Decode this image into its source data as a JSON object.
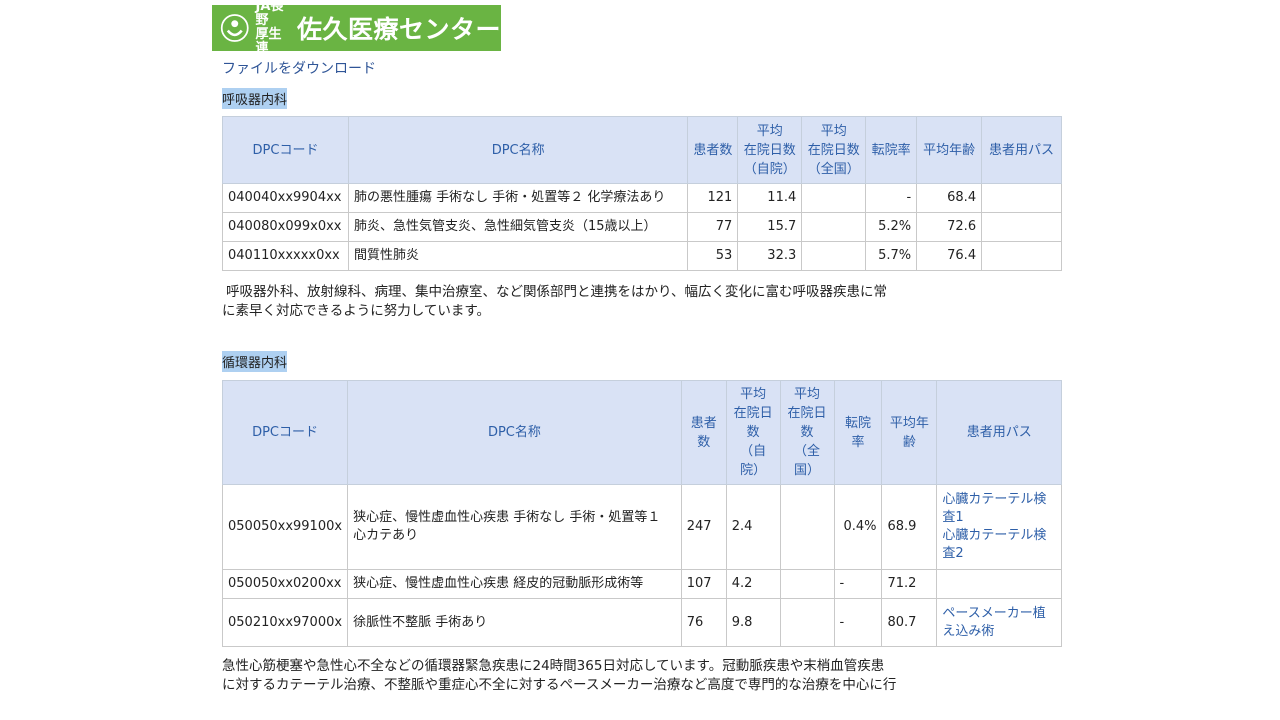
{
  "logo": {
    "line1": "JA長野",
    "line2": "厚生連",
    "name": "佐久医療センター",
    "brand_color": "#6ab443"
  },
  "download_link": "ファイルをダウンロード",
  "sections": [
    {
      "title": "呼吸器内科",
      "headers": {
        "code": "DPCコード",
        "name": "DPC名称",
        "patients": "患者数",
        "avg_days_hospital": [
          "平均",
          "在院日数",
          "（自院）"
        ],
        "avg_days_national": [
          "平均",
          "在院日数",
          "（全国）"
        ],
        "transfer": "転院率",
        "avg_age": "平均年齢",
        "path": "患者用パス"
      },
      "rows": [
        {
          "code": "040040xx9904xx",
          "name": "肺の悪性腫瘍 手術なし 手術・処置等２ 化学療法あり",
          "patients": "121",
          "days_hospital": "11.4",
          "days_national": "",
          "transfer": "-",
          "age": "68.4",
          "path": []
        },
        {
          "code": "040080x099x0xx",
          "name": "肺炎、急性気管支炎、急性細気管支炎（15歳以上）",
          "patients": "77",
          "days_hospital": "15.7",
          "days_national": "",
          "transfer": "5.2%",
          "age": "72.6",
          "path": []
        },
        {
          "code": "040110xxxxx0xx",
          "name": "間質性肺炎",
          "patients": "53",
          "days_hospital": "32.3",
          "days_national": "",
          "transfer": "5.7%",
          "age": "76.4",
          "path": []
        }
      ],
      "description": [
        "呼吸器外科、放射線科、病理、集中治療室、など関係部門と連携をはかり、幅広く変化に富む呼吸器疾患に常",
        "に素早く対応できるように努力しています。"
      ]
    },
    {
      "title": "循環器内科",
      "headers": {
        "code": "DPCコード",
        "name": "DPC名称",
        "patients": [
          "患者",
          "数"
        ],
        "avg_days_hospital": [
          "平均",
          "在院日",
          "数",
          "（自",
          "院）"
        ],
        "avg_days_national": [
          "平均",
          "在院日",
          "数",
          "（全",
          "国）"
        ],
        "transfer": [
          "転院",
          "率"
        ],
        "avg_age": [
          "平均年",
          "齢"
        ],
        "path": "患者用パス"
      },
      "rows": [
        {
          "code": "050050xx99100x",
          "name": [
            "狭心症、慢性虚血性心疾患 手術なし 手術・処置等１",
            "心カテあり"
          ],
          "patients": "247",
          "days_hospital": "2.4",
          "days_national": "",
          "transfer": "0.4%",
          "age": "68.9",
          "path": [
            [
              "心臓カテーテル検",
              "査1"
            ],
            [
              "心臓カテーテル検",
              "査2"
            ]
          ]
        },
        {
          "code": "050050xx0200xx",
          "name": [
            "狭心症、慢性虚血性心疾患 経皮的冠動脈形成術等"
          ],
          "patients": "107",
          "days_hospital": "4.2",
          "days_national": "",
          "transfer": "-",
          "age": "71.2",
          "path": []
        },
        {
          "code": "050210xx97000x",
          "name": [
            "徐脈性不整脈 手術あり"
          ],
          "patients": "76",
          "days_hospital": "9.8",
          "days_national": "",
          "transfer": "-",
          "age": "80.7",
          "path": [
            [
              "ペースメーカー植",
              "え込み術"
            ]
          ]
        }
      ],
      "description": [
        "急性心筋梗塞や急性心不全などの循環器緊急疾患に24時間365日対応しています。冠動脈疾患や末梢血管疾患",
        "に対するカテーテル治療、不整脈や重症心不全に対するペースメーカー治療など高度で専門的な治療を中心に行"
      ]
    }
  ]
}
